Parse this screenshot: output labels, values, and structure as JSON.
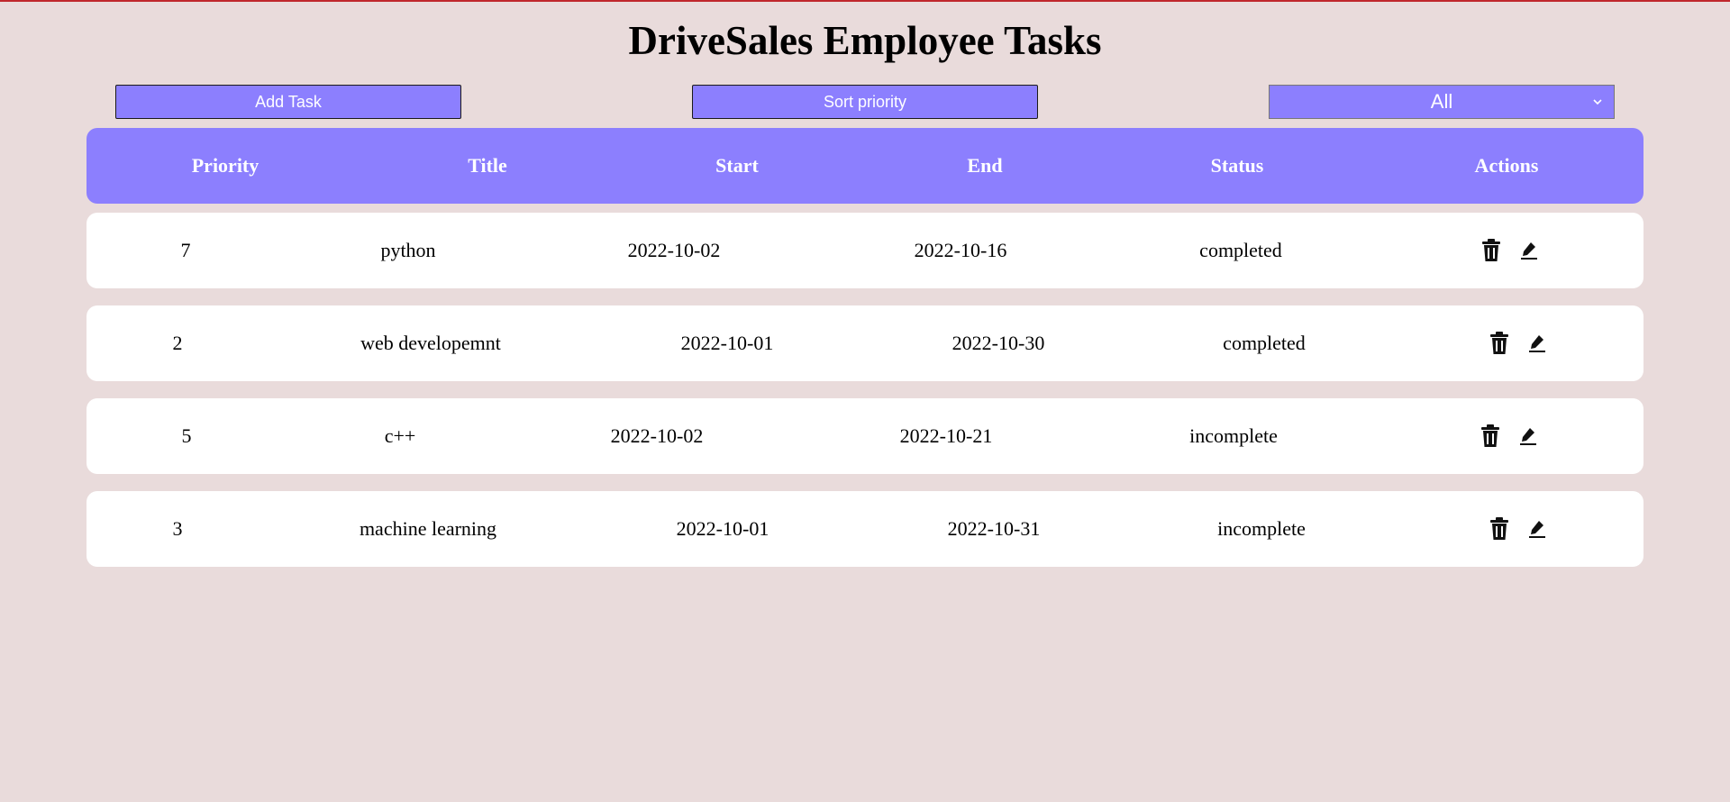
{
  "page": {
    "title": "DriveSales Employee Tasks"
  },
  "toolbar": {
    "add_label": "Add Task",
    "sort_label": "Sort priority",
    "filter_value": "All"
  },
  "table": {
    "headers": [
      "Priority",
      "Title",
      "Start",
      "End",
      "Status",
      "Actions"
    ],
    "rows": [
      {
        "priority": "7",
        "title": "python",
        "start": "2022-10-02",
        "end": "2022-10-16",
        "status": "completed"
      },
      {
        "priority": "2",
        "title": "web developemnt",
        "start": "2022-10-01",
        "end": "2022-10-30",
        "status": "completed"
      },
      {
        "priority": "5",
        "title": "c++",
        "start": "2022-10-02",
        "end": "2022-10-21",
        "status": "incomplete"
      },
      {
        "priority": "3",
        "title": "machine learning",
        "start": "2022-10-01",
        "end": "2022-10-31",
        "status": "incomplete"
      }
    ],
    "row_actions": [
      "trash-icon",
      "pencil-icon"
    ]
  },
  "colors": {
    "background": "#e9dbdb",
    "accent": "#8c7ffe",
    "row_background": "#ffffff",
    "top_border": "#c0272d"
  }
}
